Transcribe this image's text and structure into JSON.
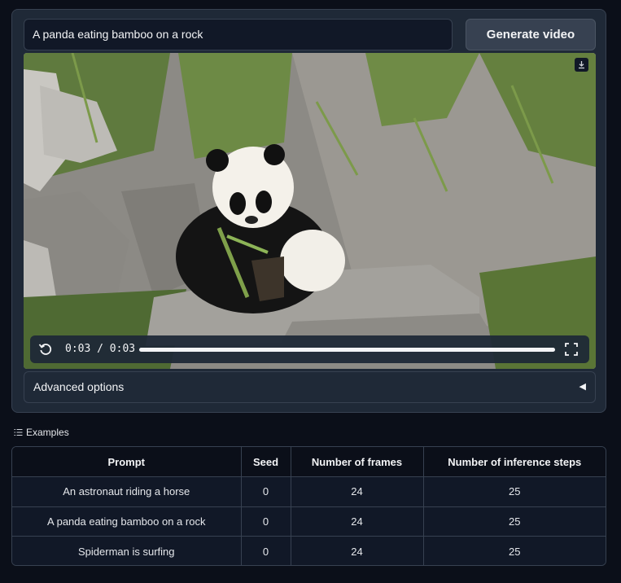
{
  "prompt": {
    "value": "A panda eating bamboo on a rock"
  },
  "generate_button": {
    "label": "Generate video"
  },
  "video": {
    "time": "0:03 / 0:03",
    "progress": 1.0
  },
  "advanced": {
    "label": "Advanced options",
    "arrow": "◀"
  },
  "examples": {
    "label": "Examples",
    "headers": [
      "Prompt",
      "Seed",
      "Number of frames",
      "Number of inference steps"
    ],
    "rows": [
      [
        "An astronaut riding a horse",
        "0",
        "24",
        "25"
      ],
      [
        "A panda eating bamboo on a rock",
        "0",
        "24",
        "25"
      ],
      [
        "Spiderman is surfing",
        "0",
        "24",
        "25"
      ]
    ]
  },
  "colors": {
    "background": "#0b0f19",
    "panel": "#1f2937",
    "border": "#374151"
  }
}
